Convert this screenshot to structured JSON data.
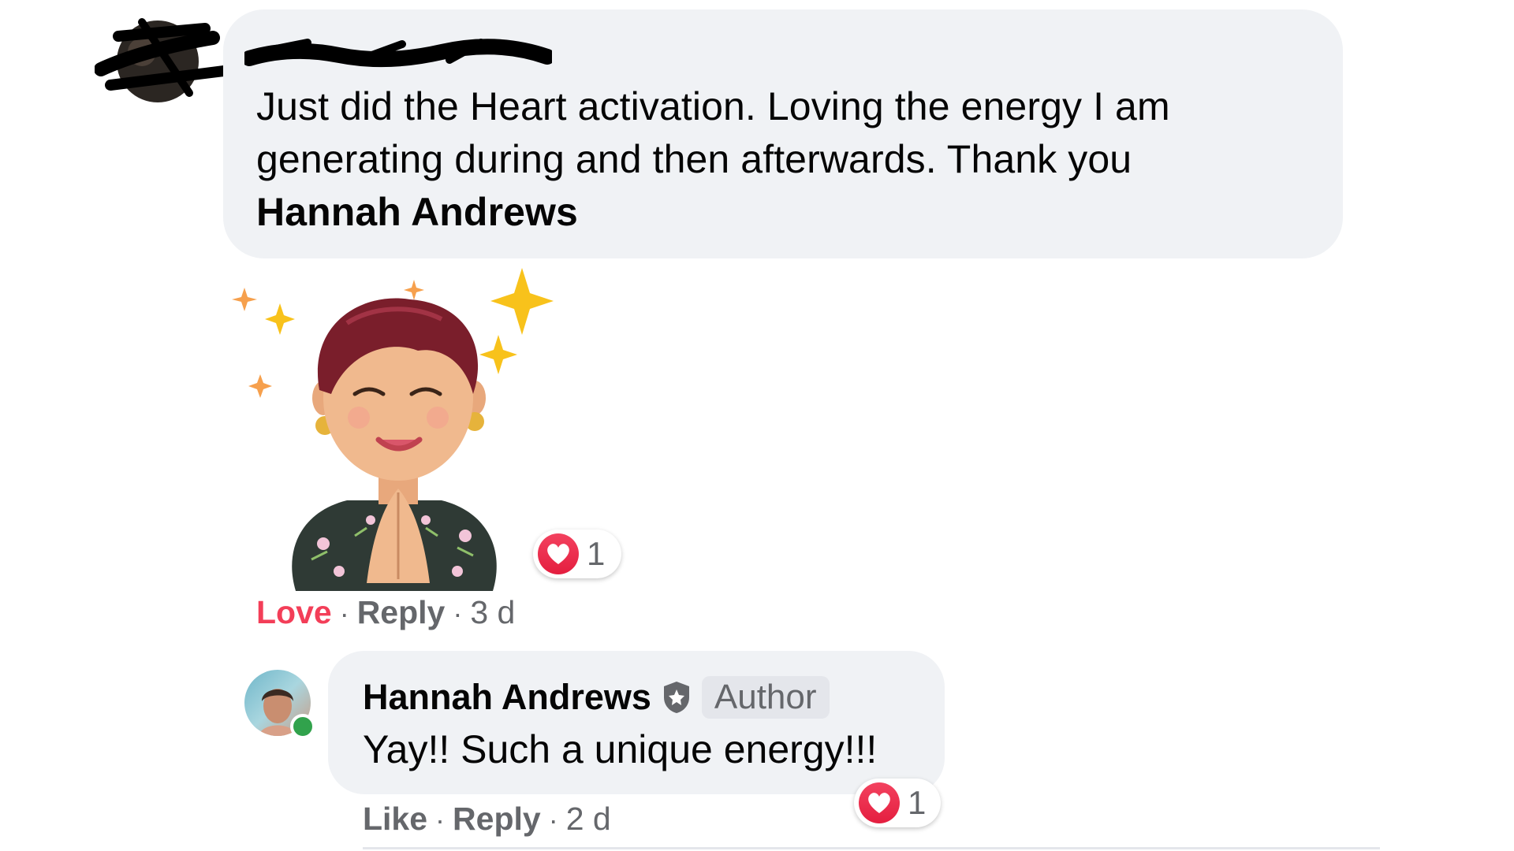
{
  "top_comment": {
    "text_lines": [
      "Just did the Heart activation. Loving the energy I am",
      "generating during and then afterwards. Thank you"
    ],
    "mention": "Hannah Andrews",
    "reaction_count": "1",
    "actions": {
      "react_label": "Love",
      "reply_label": "Reply",
      "time": "3 d"
    }
  },
  "reply": {
    "author": "Hannah Andrews",
    "badge": "Author",
    "text": "Yay!! Such a unique energy!!!",
    "reaction_count": "1",
    "actions": {
      "react_label": "Like",
      "reply_label": "Reply",
      "time": "2 d"
    }
  },
  "separator": "·",
  "colors": {
    "bubble": "#f0f2f5",
    "love": "#f33e58",
    "meta": "#65676b",
    "heart": "#e41e3f",
    "online": "#31a24c"
  },
  "icons": {
    "reaction": "heart-icon",
    "verified": "shield-icon",
    "sparkles": "sparkle-icon"
  }
}
